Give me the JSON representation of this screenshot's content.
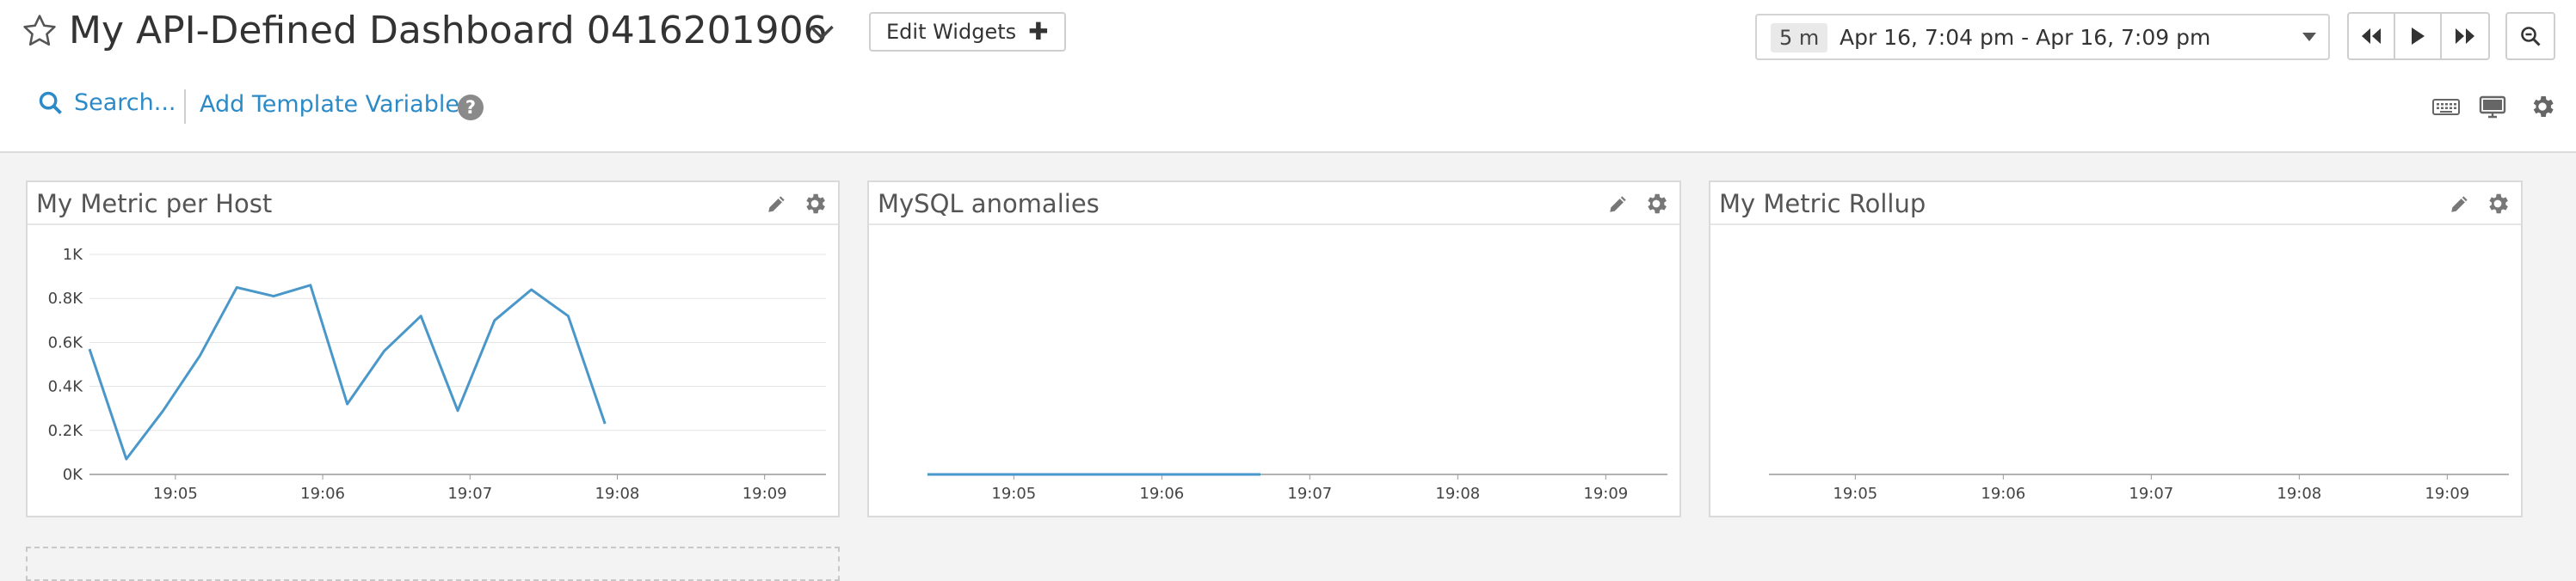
{
  "header": {
    "title": "My API-Defined Dashboard 0416201906",
    "edit_widgets_label": "Edit Widgets",
    "time": {
      "badge": "5 m",
      "range": "Apr 16, 7:04 pm - Apr 16, 7:09 pm"
    },
    "controls": [
      "rewind-icon",
      "play-icon",
      "fast-forward-icon",
      "zoom-icon"
    ]
  },
  "toolbar": {
    "search_label": "Search...",
    "template_vars_label": "Add Template Variables",
    "help_glyph": "?",
    "right_icons": [
      "keyboard-icon",
      "monitor-icon",
      "gear-icon"
    ]
  },
  "colors": {
    "accent": "#2c8ac7",
    "line": "#4a97c9"
  },
  "widgets": [
    {
      "title": "My Metric per Host",
      "chart_data": {
        "type": "line",
        "x_ticks": [
          "19:05",
          "19:06",
          "19:07",
          "19:08",
          "19:09"
        ],
        "y_ticks": [
          "0K",
          "0.2K",
          "0.4K",
          "0.6K",
          "0.8K",
          "1K"
        ],
        "ylim": [
          0,
          1000
        ],
        "grid": true,
        "series": [
          {
            "x": [
              "19:04:25",
              "19:04:40",
              "19:04:55",
              "19:05:10",
              "19:05:25",
              "19:05:40",
              "19:05:55",
              "19:06:10",
              "19:06:25",
              "19:06:40",
              "19:06:55",
              "19:07:10",
              "19:07:25",
              "19:07:40",
              "19:07:55"
            ],
            "values": [
              570,
              70,
              290,
              540,
              850,
              810,
              860,
              320,
              560,
              720,
              290,
              700,
              840,
              720,
              230
            ]
          }
        ]
      }
    },
    {
      "title": "MySQL anomalies",
      "chart_data": {
        "type": "line",
        "x_ticks": [
          "19:05",
          "19:06",
          "19:07",
          "19:08",
          "19:09"
        ],
        "y_ticks": [],
        "grid": false,
        "series": [
          {
            "x": [
              "19:04:25",
              "19:06:40"
            ],
            "values": [
              0,
              0
            ]
          }
        ]
      }
    },
    {
      "title": "My Metric Rollup",
      "chart_data": {
        "type": "line",
        "x_ticks": [
          "19:05",
          "19:06",
          "19:07",
          "19:08",
          "19:09"
        ],
        "y_ticks": [],
        "grid": false,
        "series": []
      }
    }
  ]
}
